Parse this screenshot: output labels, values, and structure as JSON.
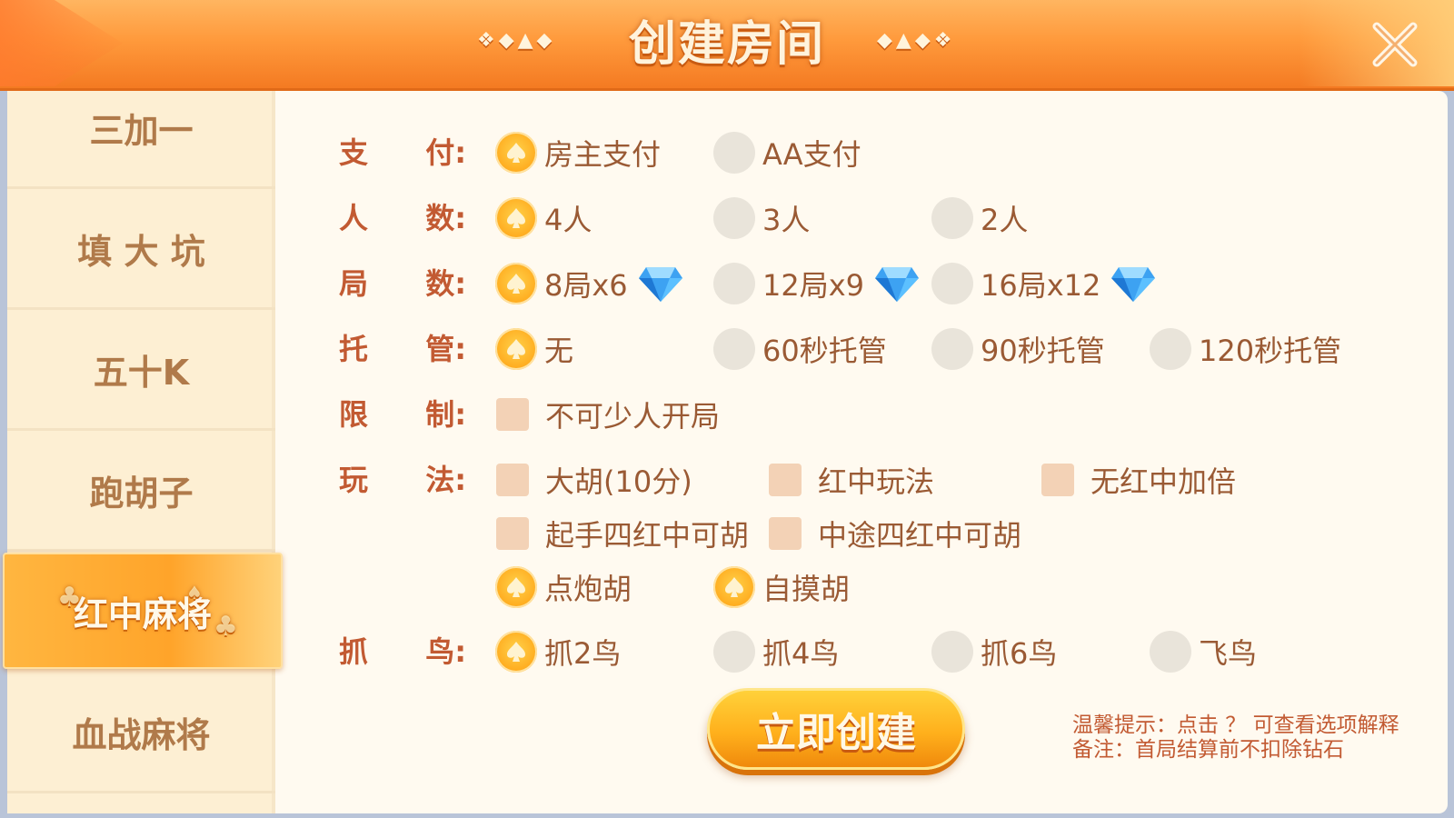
{
  "header": {
    "title": "创建房间",
    "deco_left": "❖◆▲◆",
    "deco_right": "◆▲◆❖"
  },
  "sidebar": {
    "items": [
      {
        "label": "三加一"
      },
      {
        "label": "填 大 坑"
      },
      {
        "label": "五十K"
      },
      {
        "label": "跑胡子"
      },
      {
        "label": "红中麻将",
        "active": true
      },
      {
        "label": "血战麻将"
      }
    ]
  },
  "rows": {
    "pay": {
      "label_a": "支",
      "label_b": "付:",
      "options": [
        "房主支付",
        "AA支付"
      ],
      "selected": 0
    },
    "players": {
      "label_a": "人",
      "label_b": "数:",
      "options": [
        "4人",
        "3人",
        "2人"
      ],
      "selected": 0
    },
    "rounds": {
      "label_a": "局",
      "label_b": "数:",
      "options": [
        "8局x6",
        "12局x9",
        "16局x12"
      ],
      "selected": 0
    },
    "trustee": {
      "label_a": "托",
      "label_b": "管:",
      "options": [
        "无",
        "60秒托管",
        "90秒托管",
        "120秒托管"
      ],
      "selected": 0
    },
    "limit": {
      "label_a": "限",
      "label_b": "制:",
      "checks": [
        "不可少人开局"
      ]
    },
    "rules": {
      "label_a": "玩",
      "label_b": "法:",
      "checks": [
        "大胡(10分)",
        "红中玩法",
        "无红中加倍",
        "起手四红中可胡",
        "中途四红中可胡"
      ],
      "hu_options": [
        "点炮胡",
        "自摸胡"
      ]
    },
    "birds": {
      "label_a": "抓",
      "label_b": "鸟:",
      "options": [
        "抓2鸟",
        "抓4鸟",
        "抓6鸟",
        "飞鸟"
      ],
      "selected": 0
    }
  },
  "create_button": "立即创建",
  "tips": {
    "line1": "温馨提示：点击 ？ 可查看选项解释",
    "line2": "备注：首局结算前不扣除钻石"
  },
  "colors": {
    "accent_orange": "#ffab1e",
    "label_red": "#c25a32",
    "option_brown": "#9a5a34"
  }
}
